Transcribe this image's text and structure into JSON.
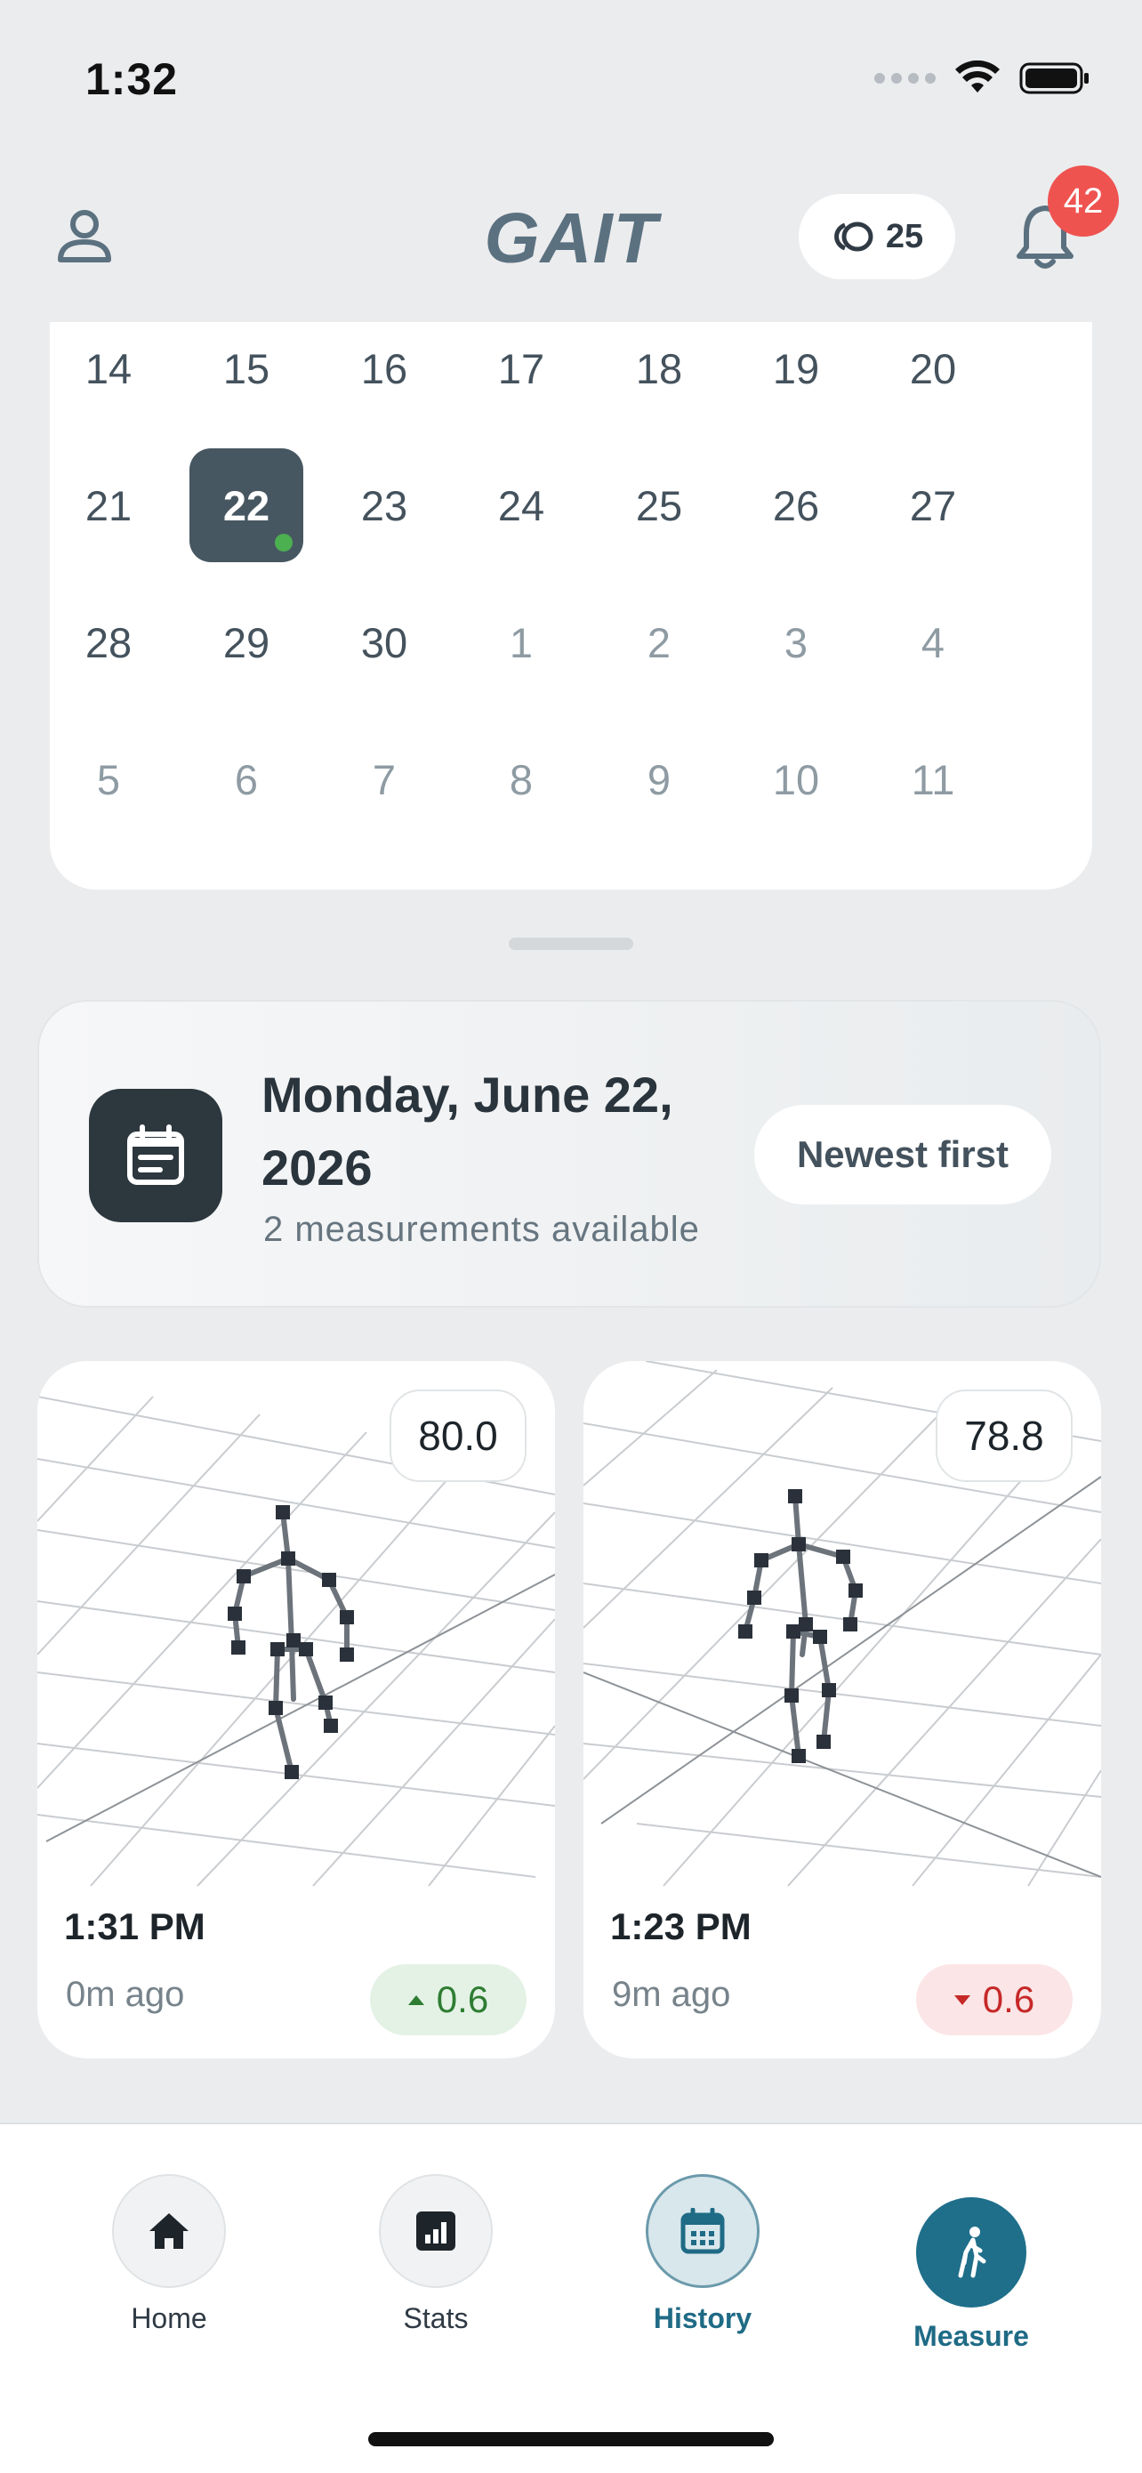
{
  "status_bar": {
    "time": "1:32"
  },
  "header": {
    "app_title": "GAIT",
    "credits": "25",
    "notifications_count": "42"
  },
  "calendar": {
    "rows": [
      [
        {
          "d": "14"
        },
        {
          "d": "15"
        },
        {
          "d": "16"
        },
        {
          "d": "17"
        },
        {
          "d": "18"
        },
        {
          "d": "19"
        },
        {
          "d": "20"
        }
      ],
      [
        {
          "d": "21"
        },
        {
          "d": "22",
          "selected": true,
          "has_data": true
        },
        {
          "d": "23"
        },
        {
          "d": "24"
        },
        {
          "d": "25"
        },
        {
          "d": "26"
        },
        {
          "d": "27"
        }
      ],
      [
        {
          "d": "28"
        },
        {
          "d": "29"
        },
        {
          "d": "30"
        },
        {
          "d": "1",
          "muted": true
        },
        {
          "d": "2",
          "muted": true
        },
        {
          "d": "3",
          "muted": true
        },
        {
          "d": "4",
          "muted": true
        }
      ],
      [
        {
          "d": "5",
          "muted": true
        },
        {
          "d": "6",
          "muted": true
        },
        {
          "d": "7",
          "muted": true
        },
        {
          "d": "8",
          "muted": true
        },
        {
          "d": "9",
          "muted": true
        },
        {
          "d": "10",
          "muted": true
        },
        {
          "d": "11",
          "muted": true
        }
      ]
    ]
  },
  "day_summary": {
    "date_title": "Monday, June 22, 2026",
    "subtitle": "2 measurements available",
    "sort_label": "Newest first"
  },
  "measurements": [
    {
      "score": "80.0",
      "time": "1:31 PM",
      "ago": "0m ago",
      "delta": "0.6",
      "trend": "up"
    },
    {
      "score": "78.8",
      "time": "1:23 PM",
      "ago": "9m ago",
      "delta": "0.6",
      "trend": "down"
    }
  ],
  "nav": {
    "home": "Home",
    "stats": "Stats",
    "history": "History",
    "measure": "Measure"
  },
  "colors": {
    "accent": "#1f6f8b",
    "selected_day": "#475761",
    "positive": "#2e7d32",
    "negative": "#c62828",
    "badge": "#ef5350"
  }
}
